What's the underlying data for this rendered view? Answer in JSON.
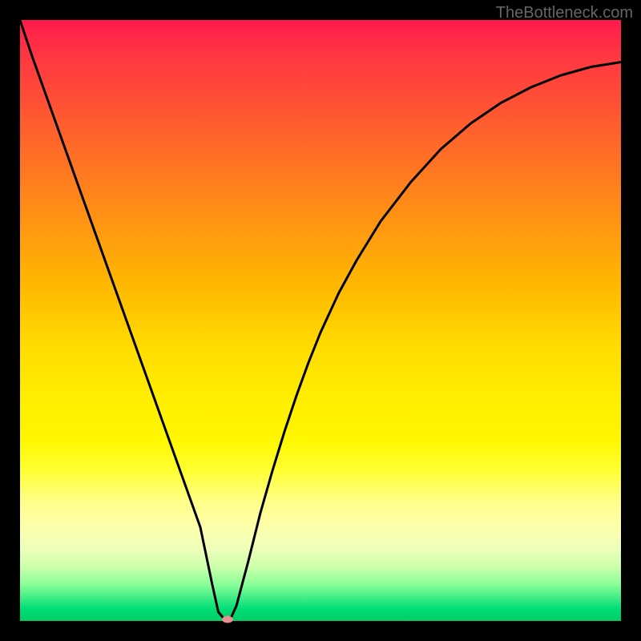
{
  "watermark": "TheBottleneck.com",
  "chart_data": {
    "type": "line",
    "title": "",
    "xlabel": "",
    "ylabel": "",
    "xlim": [
      0,
      100
    ],
    "ylim": [
      0,
      100
    ],
    "x": [
      0,
      2,
      4,
      6,
      8,
      10,
      12,
      14,
      16,
      18,
      20,
      22,
      24,
      26,
      28,
      30,
      32,
      33,
      34,
      35,
      36,
      38,
      40,
      42,
      44,
      46,
      48,
      50,
      53,
      56,
      60,
      65,
      70,
      75,
      80,
      85,
      90,
      95,
      100
    ],
    "y": [
      100,
      94,
      88.4,
      82.8,
      77.2,
      71.6,
      66,
      60.4,
      54.8,
      49.2,
      43.6,
      38,
      32.4,
      26.8,
      21.2,
      15.6,
      6,
      1.5,
      0.3,
      0.3,
      2.5,
      10,
      18,
      25,
      31.5,
      37.5,
      43,
      48,
      54.5,
      60,
      66.5,
      73,
      78.5,
      82.8,
      86.2,
      88.8,
      90.8,
      92.2,
      93
    ],
    "marker": {
      "x": 34.5,
      "y": 0.3,
      "color": "#e89090"
    },
    "annotations": []
  }
}
